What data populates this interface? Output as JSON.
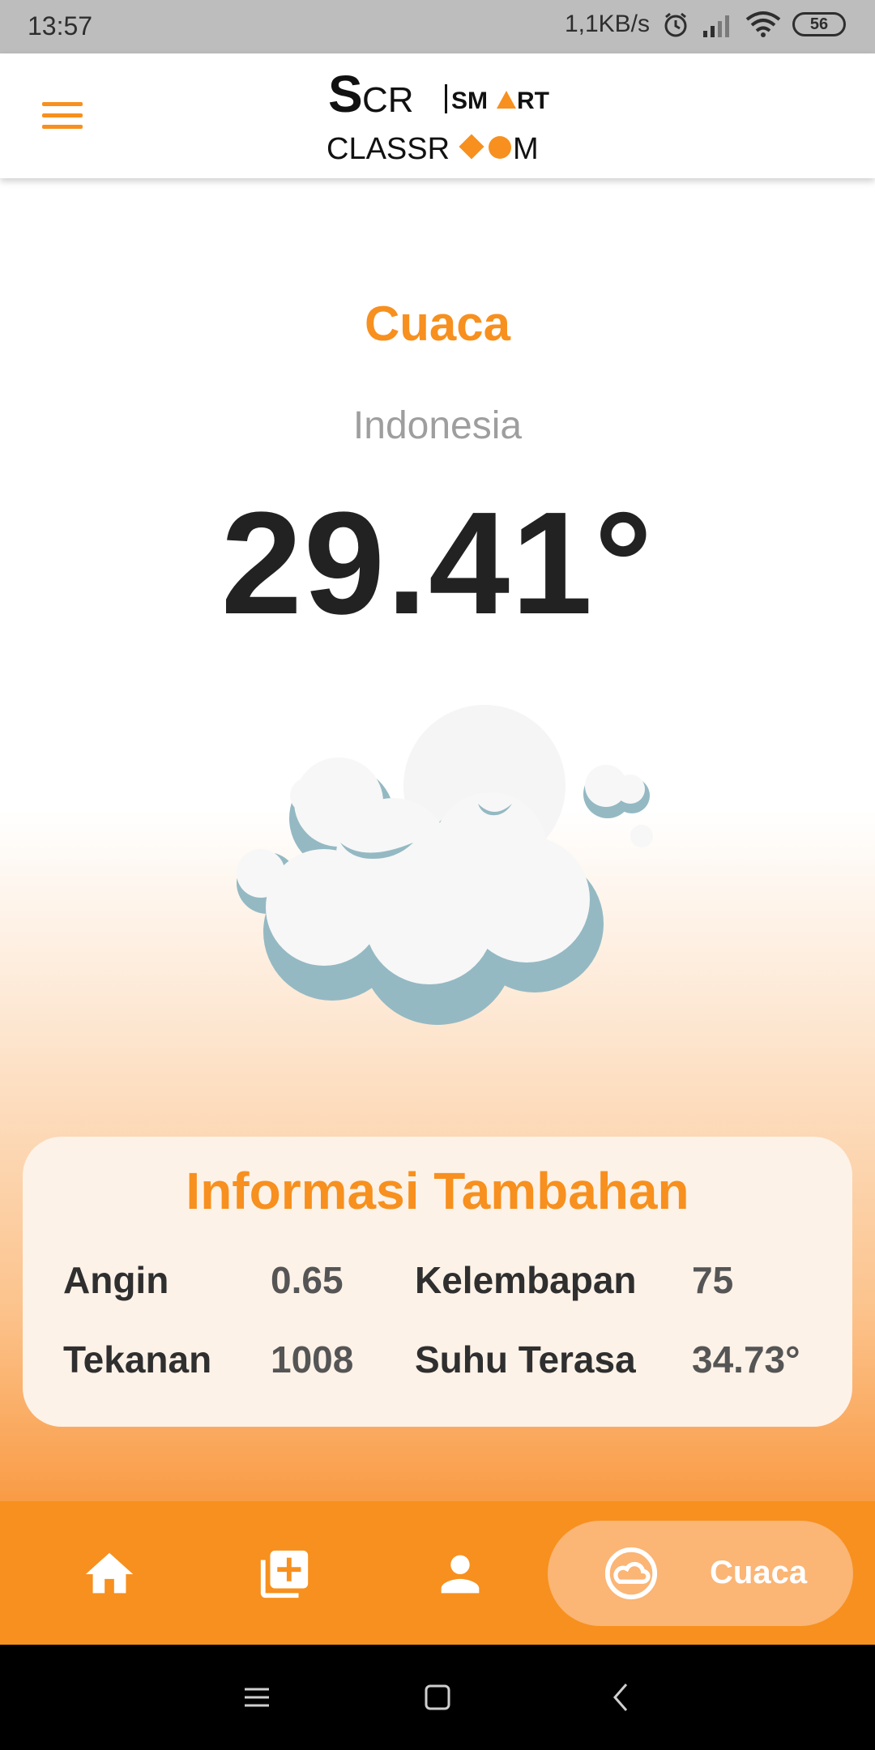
{
  "status_bar": {
    "time": "13:57",
    "net_speed": "1,1KB/s",
    "battery": "56"
  },
  "app_bar": {
    "logo_top": "SCR",
    "logo_smart": "SMART",
    "logo_bottom_left": "CLASSR",
    "logo_bottom_right": "M"
  },
  "weather": {
    "title": "Cuaca",
    "location": "Indonesia",
    "temperature": "29.41°"
  },
  "info": {
    "title": "Informasi Tambahan",
    "wind_label": "Angin",
    "wind_value": "0.65",
    "humidity_label": "Kelembapan",
    "humidity_value": "75",
    "pressure_label": "Tekanan",
    "pressure_value": "1008",
    "feels_label": "Suhu Terasa",
    "feels_value": "34.73°"
  },
  "bottom_nav": {
    "items": [
      {
        "icon": "home-icon"
      },
      {
        "icon": "add-library-icon"
      },
      {
        "icon": "person-icon"
      },
      {
        "icon": "cloud-icon",
        "label": "Cuaca",
        "active": true
      }
    ]
  },
  "colors": {
    "accent": "#f7901e",
    "card_bg": "#fdf2e8",
    "active_pill": "#fbb575"
  }
}
